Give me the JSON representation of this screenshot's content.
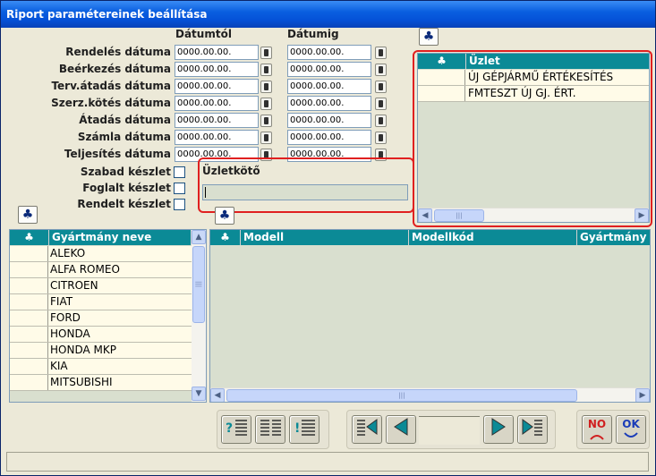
{
  "window": {
    "title": "Riport paramétereinek beállítása"
  },
  "date_columns": {
    "from": "Dátumtól",
    "to": "Dátumig"
  },
  "date_rows": [
    {
      "label": "Rendelés dátuma",
      "from": "0000.00.00.",
      "to": "0000.00.00."
    },
    {
      "label": "Beérkezés dátuma",
      "from": "0000.00.00.",
      "to": "0000.00.00."
    },
    {
      "label": "Terv.átadás dátuma",
      "from": "0000.00.00.",
      "to": "0000.00.00."
    },
    {
      "label": "Szerz.kötés dátuma",
      "from": "0000.00.00.",
      "to": "0000.00.00."
    },
    {
      "label": "Átadás dátuma",
      "from": "0000.00.00.",
      "to": "0000.00.00."
    },
    {
      "label": "Számla dátuma",
      "from": "0000.00.00.",
      "to": "0000.00.00."
    },
    {
      "label": "Teljesítés dátuma",
      "from": "0000.00.00.",
      "to": "0000.00.00."
    }
  ],
  "stock_checks": [
    {
      "label": "Szabad készlet",
      "checked": false
    },
    {
      "label": "Foglalt készlet",
      "checked": false
    },
    {
      "label": "Rendelt készlet",
      "checked": false
    }
  ],
  "dealmaker": {
    "title": "Üzletkötő",
    "value": ""
  },
  "icons": {
    "club": "♣",
    "scroll_left": "◀",
    "scroll_right": "▶",
    "scroll_up": "▲",
    "scroll_down": "▼",
    "grip": "|||"
  },
  "shop_grid": {
    "header": "Üzlet",
    "rows": [
      "ÚJ GÉPJÁRMŰ ÉRTÉKESÍTÉS",
      "FMTESZT ÚJ GJ. ÉRT."
    ]
  },
  "maker_grid": {
    "header": "Gyártmány neve",
    "rows": [
      "ALEKO",
      "ALFA ROMEO",
      "CITROEN",
      "FIAT",
      "FORD",
      "HONDA",
      "HONDA MKP",
      "KIA",
      "MITSUBISHI"
    ]
  },
  "model_grid": {
    "headers": [
      "Modell",
      "Modellkód",
      "Gyártmány"
    ]
  },
  "toolbar": {
    "no_label": "NO",
    "ok_label": "OK"
  },
  "colors": {
    "grid_header": "#0b8a96",
    "grid_bg": "#d9dfcf",
    "row_bg": "#fffbe8",
    "highlight": "#e02020",
    "title_bar": "#0a5fe0"
  }
}
